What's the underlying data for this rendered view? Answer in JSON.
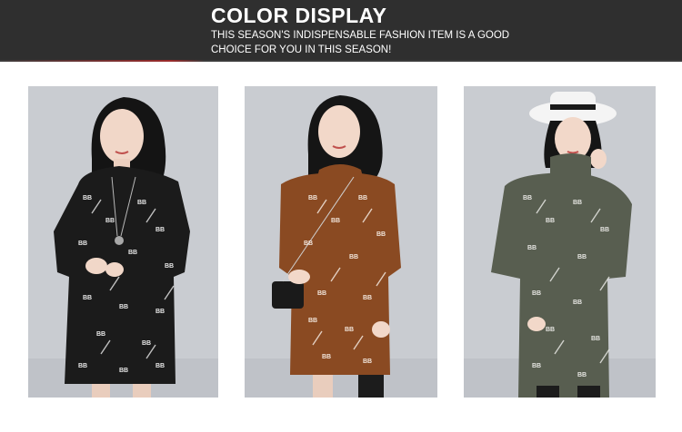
{
  "banner": {
    "title": "COLOR DISPLAY",
    "subtitle": "THIS SEASON'S INDISPENSABLE FASHION ITEM IS A GOOD CHOICE FOR YOU IN THIS SEASON!"
  },
  "photos": [
    {
      "color_name": "black",
      "dress_color": "#1b1b1b",
      "pattern_color": "#e8e8e8"
    },
    {
      "color_name": "brown",
      "dress_color": "#8a4a22",
      "pattern_color": "#f2e6dc"
    },
    {
      "color_name": "olive green",
      "dress_color": "#585e50",
      "pattern_color": "#e6e6e2"
    }
  ],
  "colors": {
    "banner_bg": "#2f2f2f",
    "photo_bg": "#c9ccd1"
  }
}
